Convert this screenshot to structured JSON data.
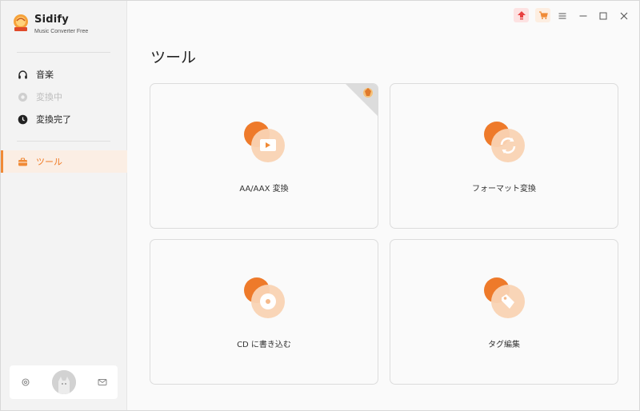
{
  "app": {
    "name": "Sidify",
    "subtitle": "Music Converter Free"
  },
  "sidebar": {
    "items": [
      {
        "label": "音楽",
        "icon": "headphones-icon",
        "state": "normal"
      },
      {
        "label": "変換中",
        "icon": "converting-icon",
        "state": "disabled"
      },
      {
        "label": "変換完了",
        "icon": "clock-icon",
        "state": "normal"
      },
      {
        "label": "ツール",
        "icon": "toolbox-icon",
        "state": "active"
      }
    ]
  },
  "footer": {
    "icons": [
      "settings-icon",
      "avatar",
      "mail-icon"
    ]
  },
  "titlebar": {
    "icons": [
      "upgrade-icon",
      "cart-icon",
      "menu-icon",
      "minimize-icon",
      "maximize-icon",
      "close-icon"
    ]
  },
  "main": {
    "title": "ツール",
    "tools": [
      {
        "label": "AA/AAX 変換",
        "icon": "video-folder-icon"
      },
      {
        "label": "フォーマット変換",
        "icon": "convert-refresh-icon"
      },
      {
        "label": "CD に書き込む",
        "icon": "cd-disc-icon"
      },
      {
        "label": "タグ編集",
        "icon": "tag-icon"
      }
    ]
  },
  "colors": {
    "accent": "#f08a36",
    "active_bg": "#fbeee4",
    "upgrade_red": "#e84040"
  }
}
